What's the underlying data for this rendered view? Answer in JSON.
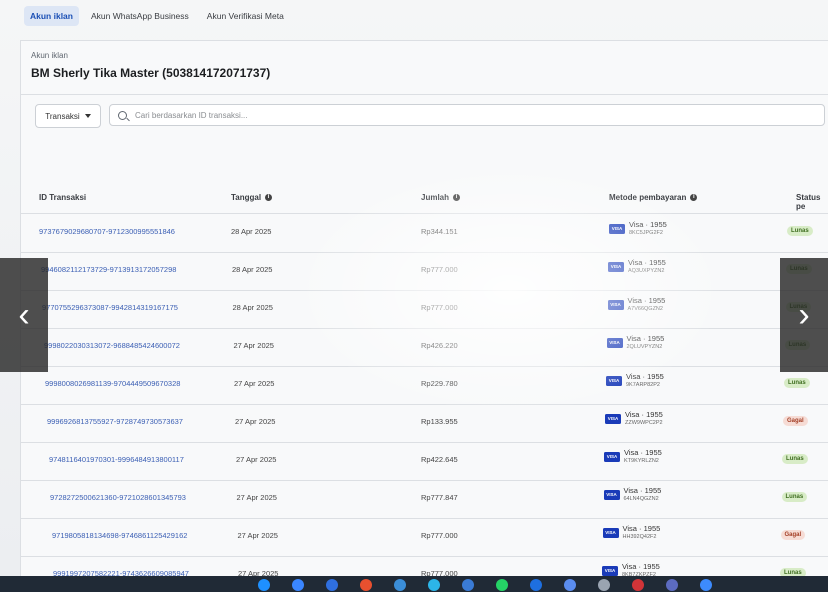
{
  "tabs": [
    {
      "label": "Akun iklan",
      "active": true
    },
    {
      "label": "Akun WhatsApp Business",
      "active": false
    },
    {
      "label": "Akun Verifikasi Meta",
      "active": false
    }
  ],
  "account": {
    "subtitle": "Akun iklan",
    "title": "BM Sherly Tika Master (503814172071737)"
  },
  "filter": {
    "label": "Transaksi"
  },
  "search": {
    "placeholder": "Cari berdasarkan ID transaksi..."
  },
  "table": {
    "headers": {
      "id": "ID Transaksi",
      "date": "Tanggal",
      "amount": "Jumlah",
      "method": "Metode pembayaran",
      "status": "Status pe"
    },
    "rows": [
      {
        "id": "9737679029680707-9712300995551846",
        "date": "28 Apr 2025",
        "amount": "Rp344.151",
        "method": "Visa · 1955",
        "code": "8KC5JPG2F2",
        "status": "Lunas",
        "status_type": "ok"
      },
      {
        "id": "9946082112173729-9713913172057298",
        "date": "28 Apr 2025",
        "amount": "Rp777.000",
        "method": "Visa · 1955",
        "code": "AQ3UXPYZN2",
        "status": "Lunas",
        "status_type": "ok"
      },
      {
        "id": "9770755296373087-9942814319167175",
        "date": "28 Apr 2025",
        "amount": "Rp777.000",
        "method": "Visa · 1955",
        "code": "A7V66QGZN2",
        "status": "Lunas",
        "status_type": "ok"
      },
      {
        "id": "9998022030313072-9688485424600072",
        "date": "27 Apr 2025",
        "amount": "Rp426.220",
        "method": "Visa · 1955",
        "code": "2QLUVPYZN2",
        "status": "Lunas",
        "status_type": "ok"
      },
      {
        "id": "9998008026981139-9704449509670328",
        "date": "27 Apr 2025",
        "amount": "Rp229.780",
        "method": "Visa · 1955",
        "code": "9K7ARP82P2",
        "status": "Lunas",
        "status_type": "ok"
      },
      {
        "id": "9996926813755927-9728749730573637",
        "date": "27 Apr 2025",
        "amount": "Rp133.955",
        "method": "Visa · 1955",
        "code": "ZZW9WPC2P2",
        "status": "Gagal",
        "status_type": "fail"
      },
      {
        "id": "9748116401970301-9996484913800117",
        "date": "27 Apr 2025",
        "amount": "Rp422.645",
        "method": "Visa · 1955",
        "code": "KT9KYRLZN2",
        "status": "Lunas",
        "status_type": "ok"
      },
      {
        "id": "9728272500621360-9721028601345793",
        "date": "27 Apr 2025",
        "amount": "Rp777.847",
        "method": "Visa · 1955",
        "code": "64LN4QGZN2",
        "status": "Lunas",
        "status_type": "ok"
      },
      {
        "id": "9719805818134698-9746861125429162",
        "date": "27 Apr 2025",
        "amount": "Rp777.000",
        "method": "Visa · 1955",
        "code": "HH392Q42F2",
        "status": "Gagal",
        "status_type": "fail"
      },
      {
        "id": "9991997207582221-9743626609085947",
        "date": "27 Apr 2025",
        "amount": "Rp777.000",
        "method": "Visa · 1955",
        "code": "8KB7ZKPZF2",
        "status": "Lunas",
        "status_type": "ok"
      }
    ]
  },
  "nav": {
    "prev_icon": "‹",
    "next_icon": "›"
  },
  "taskbar_icon_colors": [
    "#1e90ff",
    "#3a86ff",
    "#2f6fdf",
    "#e8502f",
    "#3b8ed8",
    "#2cb5e8",
    "#3a7bd5",
    "#25d366",
    "#1e6fe0",
    "#5b8def",
    "#9aa4b1",
    "#d13438",
    "#5c6bc0",
    "#3d8bfd"
  ]
}
